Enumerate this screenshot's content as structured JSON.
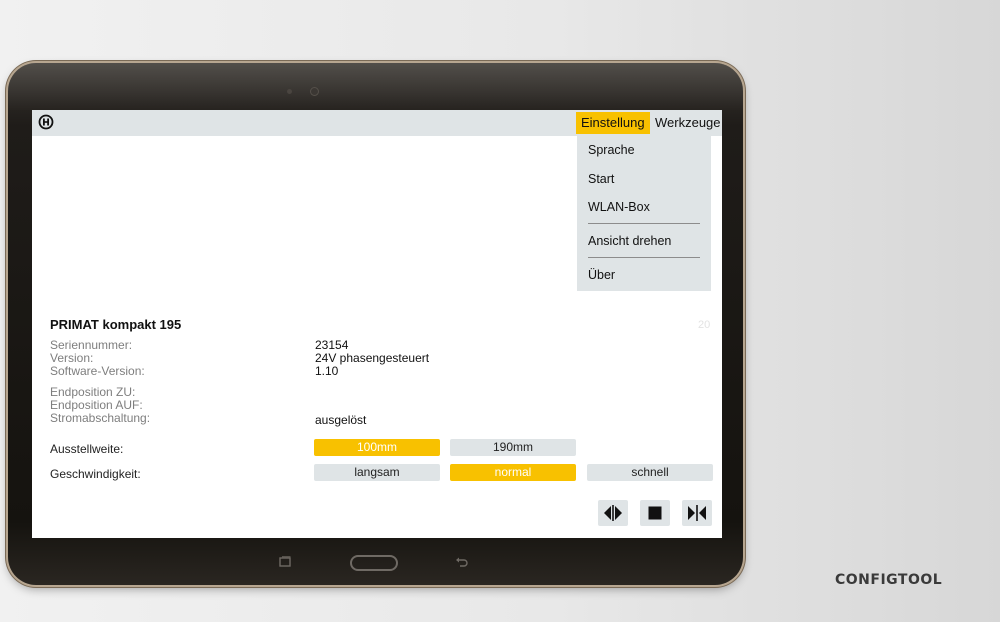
{
  "menu": {
    "tabs": [
      {
        "label": "Einstellung",
        "active": true
      },
      {
        "label": "Werkzeuge",
        "active": false
      }
    ],
    "dropdown": [
      "Sprache",
      "Start",
      "WLAN-Box",
      "Ansicht drehen",
      "Über"
    ]
  },
  "device": {
    "title": "PRIMAT kompakt 195",
    "faint_number": "20",
    "info": [
      {
        "label": "Seriennummer:",
        "value": "23154"
      },
      {
        "label": "Version:",
        "value": "24V phasengesteuert"
      },
      {
        "label": "Software-Version:",
        "value": "1.10"
      },
      {
        "label": "Endposition ZU:",
        "value": ""
      },
      {
        "label": "Endposition AUF:",
        "value": ""
      },
      {
        "label": "Stromabschaltung:",
        "value": "ausgelöst"
      }
    ]
  },
  "settings": {
    "ausstellweite": {
      "label": "Ausstellweite:",
      "options": [
        {
          "label": "100mm",
          "selected": true
        },
        {
          "label": "190mm",
          "selected": false
        }
      ]
    },
    "geschwindigkeit": {
      "label": "Geschwindigkeit:",
      "options": [
        {
          "label": "langsam",
          "selected": false
        },
        {
          "label": "normal",
          "selected": true
        },
        {
          "label": "schnell",
          "selected": false
        }
      ]
    }
  },
  "controls": [
    "open-icon",
    "stop-icon",
    "close-icon"
  ],
  "brand": "CONFIGTOOL",
  "colors": {
    "accent": "#f8c100",
    "bar": "#dfe4e6"
  }
}
